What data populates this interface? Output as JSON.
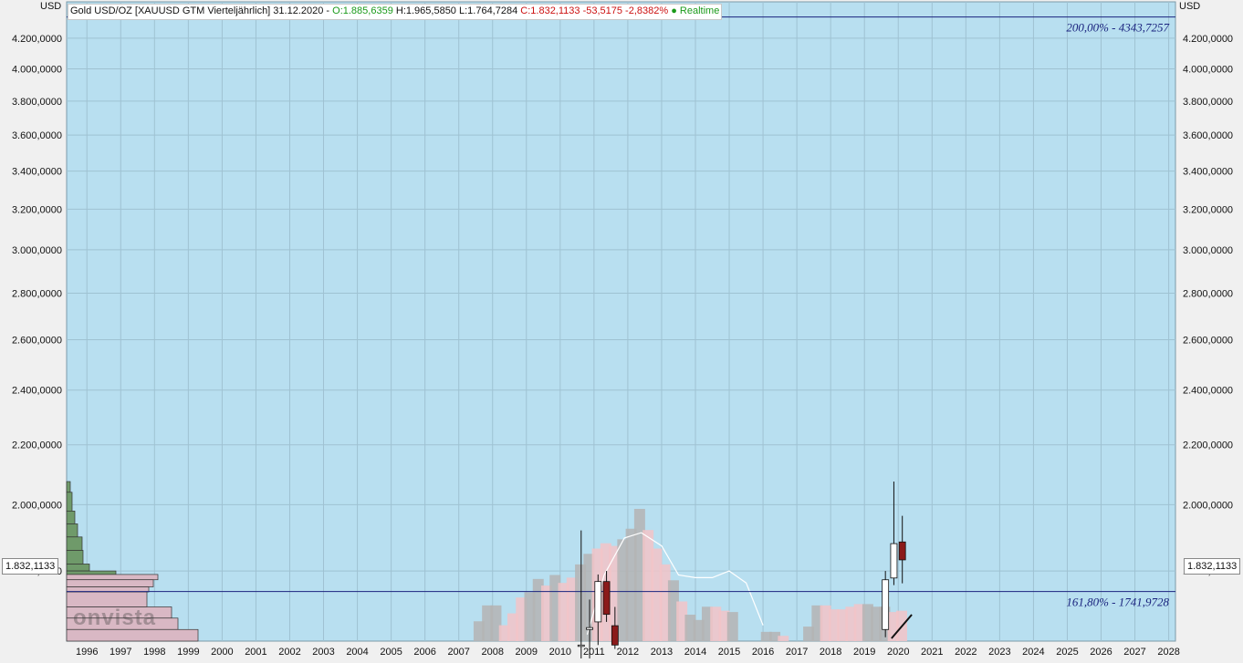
{
  "header": {
    "instrument": "Gold USD/OZ [XAUUSD GTM Vierteljährlich] 31.12.2020 -",
    "open": "O:1.885,6359",
    "high_low": "H:1.965,5850 L:1.764,7284",
    "close": "C:1.832,1133 -53,5175 -2,8382%",
    "realtime": "● Realtime"
  },
  "currency": "USD",
  "current_price_label": "1.832,1133",
  "logo_text": "onvista",
  "colors": {
    "plot_bg": "#b8dff0",
    "grid": "#9fc2d2",
    "bull_candle": "#ffffff",
    "bear_candle": "#8b1a1a",
    "volume_up": "#f2c4c8",
    "volume_down": "#b4b4b4",
    "profile_green": "#6f9a6a",
    "profile_pink": "#d9b8c4",
    "fib_line": "#1a237e"
  },
  "chart_data": {
    "type": "candlestick",
    "title": "Gold USD/OZ [XAUUSD GTM Vierteljährlich]",
    "x_tick_labels": [
      "1996",
      "1997",
      "1998",
      "1999",
      "2000",
      "2001",
      "2002",
      "2003",
      "2004",
      "2005",
      "2006",
      "2007",
      "2008",
      "2009",
      "2010",
      "2011",
      "2012",
      "2013",
      "2014",
      "2015",
      "2016",
      "2017",
      "2018",
      "2019",
      "2020",
      "2021",
      "2022",
      "2023",
      "2024",
      "2025",
      "2026",
      "2027",
      "2028"
    ],
    "y_tick_labels": [
      "4.200,0000",
      "4.000,0000",
      "3.800,0000",
      "3.600,0000",
      "3.400,0000",
      "3.200,0000",
      "3.000,0000",
      "2.800,0000",
      "2.600,0000",
      "2.400,0000",
      "2.200,0000",
      "2.000,0000",
      "1.800,0000"
    ],
    "y_ticks": [
      4200,
      4000,
      3800,
      3600,
      3400,
      3200,
      3000,
      2800,
      2600,
      2400,
      2200,
      2000,
      1800
    ],
    "y_scale": "log",
    "ylim": [
      1610,
      4450
    ],
    "xlim": [
      1995.9,
      2028.7
    ],
    "grid": true,
    "candles": [
      {
        "t": 2011.12,
        "open": 1600,
        "high": 1920,
        "low": 1540,
        "close": 1600
      },
      {
        "t": 2011.37,
        "open": 1640,
        "high": 1720,
        "low": 1560,
        "close": 1645
      },
      {
        "t": 2011.62,
        "open": 1660,
        "high": 1790,
        "low": 1600,
        "close": 1770
      },
      {
        "t": 2011.87,
        "open": 1770,
        "high": 1800,
        "low": 1660,
        "close": 1680
      },
      {
        "t": 2012.12,
        "open": 1650,
        "high": 1700,
        "low": 1590,
        "close": 1600
      },
      {
        "t": 2020.12,
        "open": 1640,
        "high": 1800,
        "low": 1620,
        "close": 1775
      },
      {
        "t": 2020.37,
        "open": 1780,
        "high": 2075,
        "low": 1760,
        "close": 1880
      },
      {
        "t": 2020.62,
        "open": 1885,
        "high": 1965,
        "low": 1765,
        "close": 1832
      }
    ],
    "fib_levels": [
      {
        "label": "200,00% - 4343,7257",
        "value": 4343.7257
      },
      {
        "label": "161,80% - 1741,9728",
        "value": 1741.9728
      }
    ],
    "volume_bars": [
      {
        "t": 2008.1,
        "v": 0.15,
        "dir": "down"
      },
      {
        "t": 2008.35,
        "v": 0.27,
        "dir": "down"
      },
      {
        "t": 2008.6,
        "v": 0.27,
        "dir": "down"
      },
      {
        "t": 2008.85,
        "v": 0.12,
        "dir": "up"
      },
      {
        "t": 2009.1,
        "v": 0.21,
        "dir": "up"
      },
      {
        "t": 2009.35,
        "v": 0.33,
        "dir": "up"
      },
      {
        "t": 2009.6,
        "v": 0.37,
        "dir": "down"
      },
      {
        "t": 2009.85,
        "v": 0.47,
        "dir": "down"
      },
      {
        "t": 2010.1,
        "v": 0.42,
        "dir": "up"
      },
      {
        "t": 2010.35,
        "v": 0.5,
        "dir": "down"
      },
      {
        "t": 2010.6,
        "v": 0.44,
        "dir": "up"
      },
      {
        "t": 2010.85,
        "v": 0.48,
        "dir": "up"
      },
      {
        "t": 2011.1,
        "v": 0.58,
        "dir": "down"
      },
      {
        "t": 2011.35,
        "v": 0.66,
        "dir": "down"
      },
      {
        "t": 2011.6,
        "v": 0.7,
        "dir": "up"
      },
      {
        "t": 2011.85,
        "v": 0.74,
        "dir": "up"
      },
      {
        "t": 2012.1,
        "v": 0.72,
        "dir": "up"
      },
      {
        "t": 2012.35,
        "v": 0.77,
        "dir": "down"
      },
      {
        "t": 2012.6,
        "v": 0.85,
        "dir": "down"
      },
      {
        "t": 2012.85,
        "v": 1.0,
        "dir": "down"
      },
      {
        "t": 2013.1,
        "v": 0.84,
        "dir": "up"
      },
      {
        "t": 2013.35,
        "v": 0.7,
        "dir": "up"
      },
      {
        "t": 2013.6,
        "v": 0.58,
        "dir": "up"
      },
      {
        "t": 2013.85,
        "v": 0.46,
        "dir": "down"
      },
      {
        "t": 2014.1,
        "v": 0.3,
        "dir": "up"
      },
      {
        "t": 2014.35,
        "v": 0.2,
        "dir": "down"
      },
      {
        "t": 2014.6,
        "v": 0.16,
        "dir": "down"
      },
      {
        "t": 2014.85,
        "v": 0.26,
        "dir": "down"
      },
      {
        "t": 2015.1,
        "v": 0.26,
        "dir": "up"
      },
      {
        "t": 2015.35,
        "v": 0.23,
        "dir": "up"
      },
      {
        "t": 2015.6,
        "v": 0.22,
        "dir": "down"
      },
      {
        "t": 2016.6,
        "v": 0.07,
        "dir": "down"
      },
      {
        "t": 2016.85,
        "v": 0.07,
        "dir": "down"
      },
      {
        "t": 2017.1,
        "v": 0.04,
        "dir": "up"
      },
      {
        "t": 2017.85,
        "v": 0.11,
        "dir": "down"
      },
      {
        "t": 2018.1,
        "v": 0.27,
        "dir": "down"
      },
      {
        "t": 2018.35,
        "v": 0.27,
        "dir": "up"
      },
      {
        "t": 2018.6,
        "v": 0.24,
        "dir": "up"
      },
      {
        "t": 2018.85,
        "v": 0.24,
        "dir": "up"
      },
      {
        "t": 2019.1,
        "v": 0.26,
        "dir": "up"
      },
      {
        "t": 2019.35,
        "v": 0.28,
        "dir": "up"
      },
      {
        "t": 2019.6,
        "v": 0.28,
        "dir": "down"
      },
      {
        "t": 2019.85,
        "v": 0.26,
        "dir": "down"
      },
      {
        "t": 2020.1,
        "v": 0.26,
        "dir": "down"
      },
      {
        "t": 2020.35,
        "v": 0.22,
        "dir": "up"
      },
      {
        "t": 2020.6,
        "v": 0.23,
        "dir": "up"
      }
    ],
    "volume_profile": [
      {
        "low": 2040,
        "high": 2075,
        "w": 4,
        "kind": "green"
      },
      {
        "low": 1980,
        "high": 2040,
        "w": 6,
        "kind": "green"
      },
      {
        "low": 1940,
        "high": 1980,
        "w": 9,
        "kind": "green"
      },
      {
        "low": 1900,
        "high": 1940,
        "w": 12,
        "kind": "green"
      },
      {
        "low": 1860,
        "high": 1900,
        "w": 17,
        "kind": "green"
      },
      {
        "low": 1820,
        "high": 1860,
        "w": 18,
        "kind": "green"
      },
      {
        "low": 1800,
        "high": 1820,
        "w": 25,
        "kind": "green"
      },
      {
        "low": 1790,
        "high": 1800,
        "w": 54,
        "kind": "green"
      },
      {
        "low": 1775,
        "high": 1790,
        "w": 100,
        "kind": "pink"
      },
      {
        "low": 1755,
        "high": 1775,
        "w": 95,
        "kind": "pink"
      },
      {
        "low": 1741,
        "high": 1755,
        "w": 90,
        "kind": "pink"
      },
      {
        "low": 1700,
        "high": 1741,
        "w": 88,
        "kind": "pink"
      },
      {
        "low": 1670,
        "high": 1700,
        "w": 115,
        "kind": "pink"
      },
      {
        "low": 1640,
        "high": 1670,
        "w": 122,
        "kind": "pink"
      },
      {
        "low": 1610,
        "high": 1640,
        "w": 144,
        "kind": "pink"
      }
    ]
  }
}
